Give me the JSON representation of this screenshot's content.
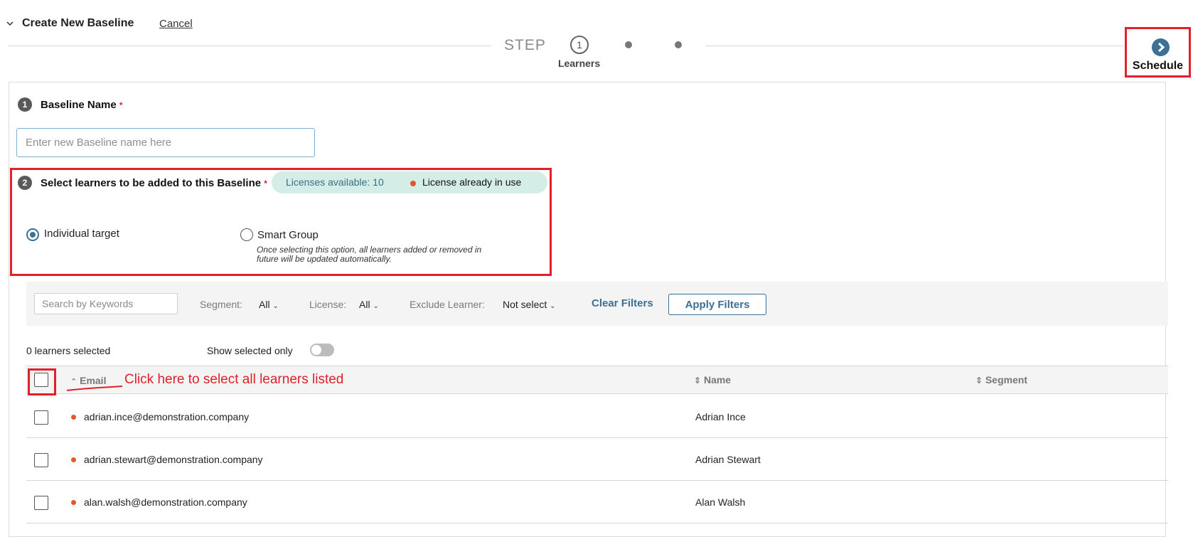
{
  "header": {
    "title": "Create New Baseline",
    "cancel_label": "Cancel",
    "step_label": "STEP",
    "current_step_number": "1",
    "current_step_name": "Learners",
    "next_label": "Schedule"
  },
  "baseline_name": {
    "number": "1",
    "label": "Baseline Name",
    "required_mark": "*",
    "placeholder": "Enter new Baseline name here",
    "value": ""
  },
  "learners_section": {
    "number": "2",
    "label": "Select learners to be added to this Baseline",
    "required_mark": "*",
    "licenses_available": "Licenses available: 10",
    "license_in_use": "License already in use",
    "options": [
      {
        "label": "Individual target",
        "selected": true
      },
      {
        "label": "Smart Group",
        "selected": false,
        "note": "Once selecting this option, all learners added or removed in future will be updated automatically."
      }
    ]
  },
  "filters": {
    "search_placeholder": "Search by Keywords",
    "segment_label": "Segment:",
    "segment_value": "All",
    "license_label": "License:",
    "license_value": "All",
    "exclude_label": "Exclude Learner:",
    "exclude_value": "Not select",
    "clear_label": "Clear Filters",
    "apply_label": "Apply Filters"
  },
  "selection": {
    "count_text": "0 learners selected",
    "show_selected_label": "Show selected only",
    "show_selected_on": false
  },
  "table": {
    "columns": [
      "Email",
      "Name",
      "Segment"
    ],
    "annotation": "Click here to select all learners listed",
    "rows": [
      {
        "email": "adrian.ince@demonstration.company",
        "name": "Adrian Ince",
        "segment": ""
      },
      {
        "email": "adrian.stewart@demonstration.company",
        "name": "Adrian Stewart",
        "segment": ""
      },
      {
        "email": "alan.walsh@demonstration.company",
        "name": "Alan Walsh",
        "segment": ""
      }
    ]
  },
  "colors": {
    "accent": "#3e6f94",
    "highlight": "#e0202a",
    "license_dot": "#e5552e",
    "license_pill": "#d5ede7"
  }
}
